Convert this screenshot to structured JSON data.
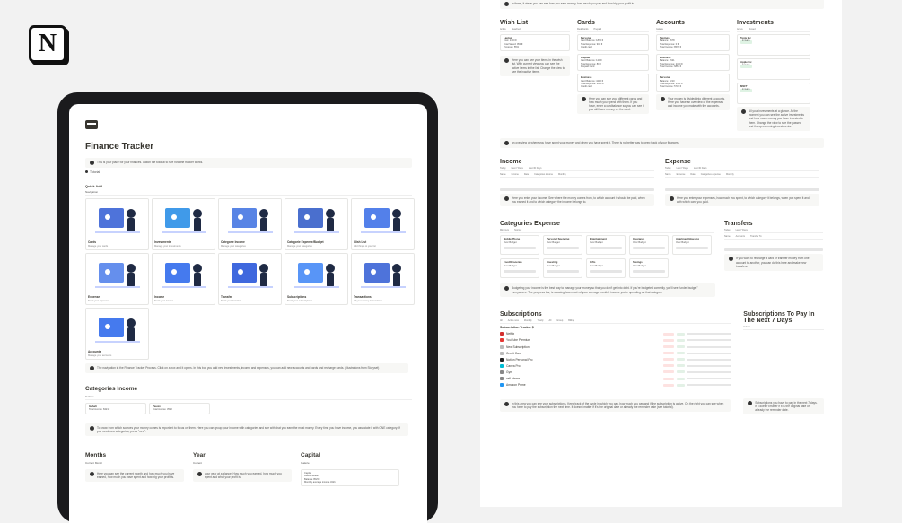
{
  "logo": {
    "letter": "N"
  },
  "left": {
    "title": "Finance Tracker",
    "intro": "This is your place for your finances. Watch the tutorial to see how the tracker works.",
    "tutorial": "Tutorial",
    "quick_add": "Quick Add",
    "navigation_tab": "Navigation",
    "nav_cards": [
      {
        "label": "Cards",
        "desc": "Manage your cards"
      },
      {
        "label": "Investments",
        "desc": "Manage your investments"
      },
      {
        "label": "Categorie Income",
        "desc": "Manage your categories"
      },
      {
        "label": "Categorie Expense/Budget",
        "desc": "Manage your categories"
      },
      {
        "label": "Wish List",
        "desc": "Add things to your list"
      },
      {
        "label": "Expense",
        "desc": "Track your expenses"
      },
      {
        "label": "Income",
        "desc": "Track your income"
      },
      {
        "label": "Transfer",
        "desc": "Track your transfers"
      },
      {
        "label": "Subscriptions",
        "desc": "Track your subscriptions"
      },
      {
        "label": "Transactions",
        "desc": "All your money transactions"
      },
      {
        "label": "Accounts",
        "desc": "Manage your accounts"
      }
    ],
    "nav_callout": "The navigation in the Finance Tracker Process. Click on a box and it opens. In this box you add new investments, income and expenses, you can add new accounts and cards and recharge cards. (Illustrations from Storyset)",
    "categories_income": "Categories Income",
    "ci_tab": "Galerie",
    "ci_items": [
      {
        "name": "Gehalt",
        "sub": "Total income: 8421€"
      },
      {
        "name": "Passiv",
        "sub": "Total income: 352€"
      }
    ],
    "ci_callout": "To know from which sources your money comes is important to focus on them. Here you can group your income with categories and see with that you earn the most money. Every time you have income, you associate it with ONE category. If you need new categories, press \"new\".",
    "months": "Months",
    "months_tab": "Current Month",
    "months_callout": "Here you can see the current month and how much you have earned, how much you have spent and how big your profit is.",
    "year": "Year",
    "year_tab": "Current",
    "year_callout": "your year at a glance. How much you earned, how much you spent and what your profit is.",
    "capital": "Capital",
    "capital_tab": "Galerie",
    "capital_lines": [
      "Capital",
      "Assets wealth",
      "Balance 9523 €",
      "Monthly average income 3421"
    ]
  },
  "right": {
    "top_callout": "In there, it views you can see how you earn money, how much you pay and how big your profit is.",
    "wishlist": {
      "title": "Wish List",
      "tabs": [
        "Active",
        "Reached"
      ],
      "card": [
        "Laptop",
        "Cost: 1700 €",
        "Total Saved: 950 €",
        "Progress: 55%"
      ],
      "callout": "Here you can see your items in the wish list. With current view you can see the active items in the list. Change the view to see the inactive items."
    },
    "cards": {
      "title": "Cards",
      "tabs": [
        "Real Cards",
        "Prepaid"
      ],
      "items": [
        {
          "name": "Personal",
          "lines": [
            "Card Balance: 1872 €",
            "Total Expense: 934 €",
            "Credit card"
          ]
        },
        {
          "name": "Prepaid",
          "lines": [
            "Card Balance: 120 €",
            "Total Expense: 80 €",
            "Prepaid Card"
          ]
        },
        {
          "name": "Business",
          "lines": [
            "Card Balance: 4210 €",
            "Total Expense: 2003 €",
            "Credit card"
          ]
        }
      ],
      "callout": "Here you can see your different cards and how much you spend with them. If you have, enter a cardbalance so you can see if you still have money on the card."
    },
    "accounts": {
      "title": "Accounts",
      "tabs": [
        "Galerie"
      ],
      "items": [
        {
          "name": "Savings",
          "lines": [
            "Balance: 8578",
            "Total Expense: 0 €",
            "Total Income: 8578 €"
          ]
        },
        {
          "name": "Business",
          "lines": [
            "Balance: 4521",
            "Total Expense: 2340 €",
            "Total Income: 6861 €"
          ]
        },
        {
          "name": "Personal",
          "lines": [
            "Balance: 2210",
            "Total Expense: 3521 €",
            "Total Income: 5731 €"
          ]
        }
      ],
      "callout": "Your money is divided into different accounts. Here you have an overview of the expenses and income you make with the accounts."
    },
    "investments": {
      "title": "Investments",
      "tabs": [
        "Active",
        "Closed"
      ],
      "items": [
        {
          "name": "Tesla Inc",
          "tag": "In Gains"
        },
        {
          "name": "Apple Inc",
          "tag": "In Gains"
        },
        {
          "name": "MSFT",
          "tag": "In Gains"
        }
      ],
      "callout": "All your investments at a glance. At the moment you can see the active investments and how much money you have invested in them. Change the view to see the passed and the up-comming investments."
    },
    "overview_callout": "an overview of where you have spent your money and when you have spent it. There is no better way to keep track of your finances.",
    "income": {
      "title": "Income",
      "tabs": [
        "Today",
        "Last 7 Days",
        "Last 30 Days"
      ],
      "cols": [
        "Name",
        "Income",
        "Date",
        "Categories income",
        "Monthly"
      ],
      "callout": "Here you enter your income. See where the money comes from, to which account it should be paid, when you earned it and to which category the income belongs to."
    },
    "expense": {
      "title": "Expense",
      "tabs": [
        "Today",
        "Last 7 Days",
        "Last 30 Days"
      ],
      "cols": [
        "Name",
        "Expense",
        "Date",
        "Categories expense",
        "Monthly"
      ],
      "callout": "Here you enter your expenses, how much you spent, to which category it belongs, when you spent it and with which card you paid."
    },
    "cat_expense": {
      "title": "Categories Expense",
      "tabs": [
        "Minimum",
        "Normal"
      ],
      "items": [
        {
          "name": "Mobile Phone",
          "sub": "Over Budget"
        },
        {
          "name": "Personal Spending",
          "sub": "Over Budget"
        },
        {
          "name": "Entertainment",
          "sub": "Over Budget"
        },
        {
          "name": "Insurance",
          "sub": "Over Budget"
        },
        {
          "name": "Apartment/Housing",
          "sub": "Over Budget"
        },
        {
          "name": "Food/Groceries",
          "sub": "Over Budget"
        },
        {
          "name": "Investing",
          "sub": "Over Budget"
        },
        {
          "name": "Gifts",
          "sub": "Over Budget"
        },
        {
          "name": "Savings",
          "sub": "Over Budget"
        }
      ],
      "callout": "Budgeting your income is the best way to manage your money so that you don't get into debt. If you're budgeted correctly, you'll see \"under budget\" everywhere. The progress bar, is showing how much of your average monthly income you're spending on that category."
    },
    "transfers": {
      "title": "Transfers",
      "tabs": [
        "Today",
        "Last 7 Days"
      ],
      "cols": [
        "Name",
        "Accounts",
        "Transfer To"
      ],
      "callout": "If you want to recharge a card or transfer money from one account to another, you can do this here and make new transfers."
    },
    "subscriptions": {
      "title": "Subscriptions",
      "tabs": [
        "All",
        "Active now",
        "Monthly",
        "Yearly",
        "All",
        "Group",
        "Billing"
      ],
      "tracker": "Subscription Tracker $",
      "rows": [
        {
          "name": "Netflix",
          "color": "#d32f2f"
        },
        {
          "name": "YouTube Premium",
          "color": "#e53935"
        },
        {
          "name": "New Subscription",
          "color": "#bbbbbb"
        },
        {
          "name": "Credit Card",
          "color": "#bbbbbb"
        },
        {
          "name": "Notion Personal Pro",
          "color": "#222222"
        },
        {
          "name": "Canva Pro",
          "color": "#00bcd4"
        },
        {
          "name": "Gym",
          "color": "#888888"
        },
        {
          "name": "cell phone",
          "color": "#888888"
        },
        {
          "name": "Amazon Prime",
          "color": "#2196f3"
        }
      ],
      "callout": "In this area you can see your subscriptions. Keep track of the cycle in which you pay, how much you pay and if the subscription is active. On the right you can see when you have to pay the subscription the next time. It doesn't matter if it's the original date or already the reminder date (see tutorial)."
    },
    "pay7": {
      "title": "Subscriptions To Pay In The Next 7 Days",
      "tab": "Galerie",
      "callout": "Subscriptions you have to pay in the next 7 days. If it doesn't matter if it is the original date or already the reminder date."
    }
  }
}
